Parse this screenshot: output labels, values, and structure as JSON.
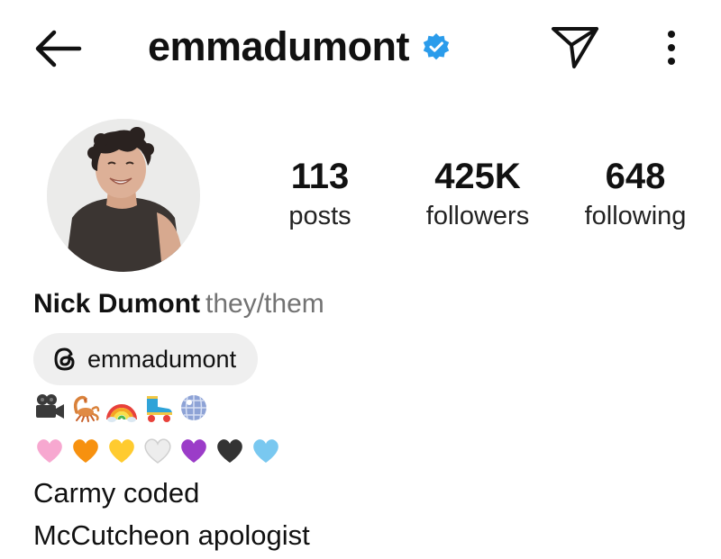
{
  "header": {
    "username": "emmadumont",
    "verified": true,
    "icons": [
      "back-arrow-icon",
      "verified-badge-icon",
      "send-message-icon",
      "more-options-icon"
    ],
    "verified_color": "#2B9CEB"
  },
  "profile": {
    "avatar": "profile-photo",
    "stats": [
      {
        "value": "113",
        "label": "posts"
      },
      {
        "value": "425K",
        "label": "followers"
      },
      {
        "value": "648",
        "label": "following"
      }
    ]
  },
  "bio": {
    "name": "Nick Dumont",
    "pronouns": "they/them",
    "threads": {
      "icon": "threads-icon",
      "handle": "emmadumont"
    },
    "emoji_line_1": [
      "movie-camera",
      "scorpion",
      "rainbow",
      "roller-skate",
      "mirror-ball"
    ],
    "emoji_line_2": [
      "pink-heart",
      "orange-heart",
      "yellow-heart",
      "white-heart",
      "purple-heart",
      "black-heart",
      "light-blue-heart"
    ],
    "heart_colors": [
      "#F7A8D0",
      "#F7910F",
      "#FFCB2F",
      "#EDEDED",
      "#9B3CC8",
      "#333333",
      "#79C8F0"
    ],
    "line_1": "Carmy coded",
    "line_2": "McCutcheon apologist"
  }
}
